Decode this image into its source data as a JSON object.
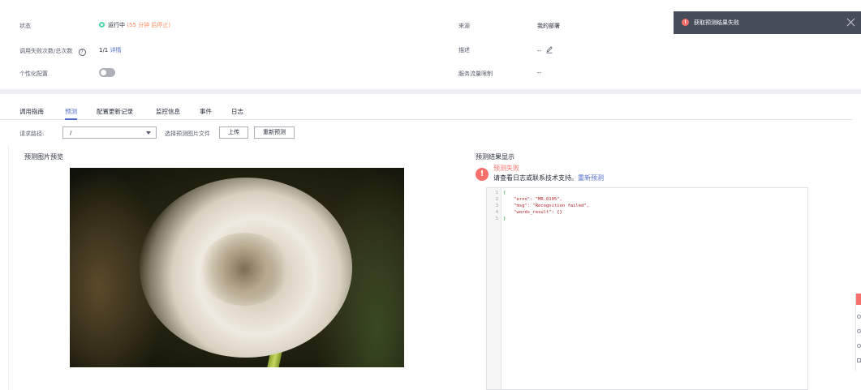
{
  "info": {
    "status_label": "状态",
    "status_value": "运行中",
    "status_note": "(55 分钟 后停止)",
    "fail_label": "调用失败次数/总次数",
    "help_glyph": "?",
    "fail_value": "1/1",
    "fail_link": "详情",
    "personal_label": "个性化配置",
    "source_label": "来源",
    "source_value": "我的部署",
    "desc_label": "描述",
    "desc_value": "--",
    "traffic_label": "服务流量限制",
    "traffic_value": "--",
    "colors": {
      "running": "#50d4ab",
      "note": "#ff8b5f",
      "link": "#526ecc"
    }
  },
  "toast": {
    "icon": "error-icon",
    "message": "获取预测结果失败",
    "close_icon": "close-icon",
    "background": "#464c59"
  },
  "tabs": [
    {
      "label": "调用指南",
      "active": false
    },
    {
      "label": "预测",
      "active": true
    },
    {
      "label": "配置更新记录",
      "active": false
    },
    {
      "label": "监控信息",
      "active": false
    },
    {
      "label": "事件",
      "active": false
    },
    {
      "label": "日志",
      "active": false
    }
  ],
  "request": {
    "path_label": "请求路径:",
    "path_value": "/",
    "file_label": "选择预测图片文件",
    "upload_button": "上传",
    "repredict_button": "重新预测"
  },
  "preview": {
    "title": "预测图片预览"
  },
  "result": {
    "title": "预测结果显示",
    "fail_title": "预测失败",
    "fail_desc": "请查看日志或联系技术支持。",
    "fail_link": "重新预测",
    "error_color": "#f66f6a",
    "code_lines": [
      {
        "n": "1",
        "text": "{"
      },
      {
        "n": "2",
        "text": "    \"erno\": \"MR.0105\","
      },
      {
        "n": "3",
        "text": "    \"msg\": \"Recognition failed\","
      },
      {
        "n": "4",
        "text": "    \"words_result\": {}"
      },
      {
        "n": "5",
        "text": "}"
      }
    ]
  }
}
